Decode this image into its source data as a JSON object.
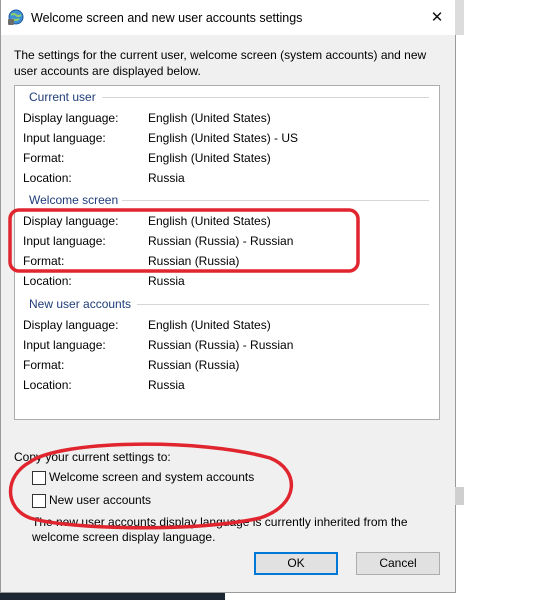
{
  "window": {
    "title": "Welcome screen and new user accounts settings",
    "close_icon": "close-icon"
  },
  "intro_text": "The settings for the current user, welcome screen (system accounts) and new user accounts are displayed below.",
  "sections": {
    "current_user": {
      "header": "Current user",
      "rows": [
        {
          "label": "Display language:",
          "value": "English (United States)"
        },
        {
          "label": "Input language:",
          "value": "English (United States) - US"
        },
        {
          "label": "Format:",
          "value": "English (United States)"
        },
        {
          "label": "Location:",
          "value": "Russia"
        }
      ]
    },
    "welcome_screen": {
      "header": "Welcome screen",
      "rows": [
        {
          "label": "Display language:",
          "value": "English (United States)"
        },
        {
          "label": "Input language:",
          "value": "Russian (Russia) - Russian"
        },
        {
          "label": "Format:",
          "value": "Russian (Russia)"
        },
        {
          "label": "Location:",
          "value": "Russia"
        }
      ]
    },
    "new_user_accounts": {
      "header": "New user accounts",
      "rows": [
        {
          "label": "Display language:",
          "value": "English (United States)"
        },
        {
          "label": "Input language:",
          "value": "Russian (Russia) - Russian"
        },
        {
          "label": "Format:",
          "value": "Russian (Russia)"
        },
        {
          "label": "Location:",
          "value": "Russia"
        }
      ]
    }
  },
  "copy_settings": {
    "label": "Copy your current settings to:",
    "options": [
      {
        "label": "Welcome screen and system accounts",
        "checked": false
      },
      {
        "label": "New user accounts",
        "checked": false
      }
    ]
  },
  "note": "The new user accounts display language is currently inherited from the welcome screen display language.",
  "buttons": {
    "ok": "OK",
    "cancel": "Cancel"
  },
  "colors": {
    "annotation": "#e0252f",
    "section_header": "#1f3d7a",
    "focus_border": "#0078d7"
  }
}
